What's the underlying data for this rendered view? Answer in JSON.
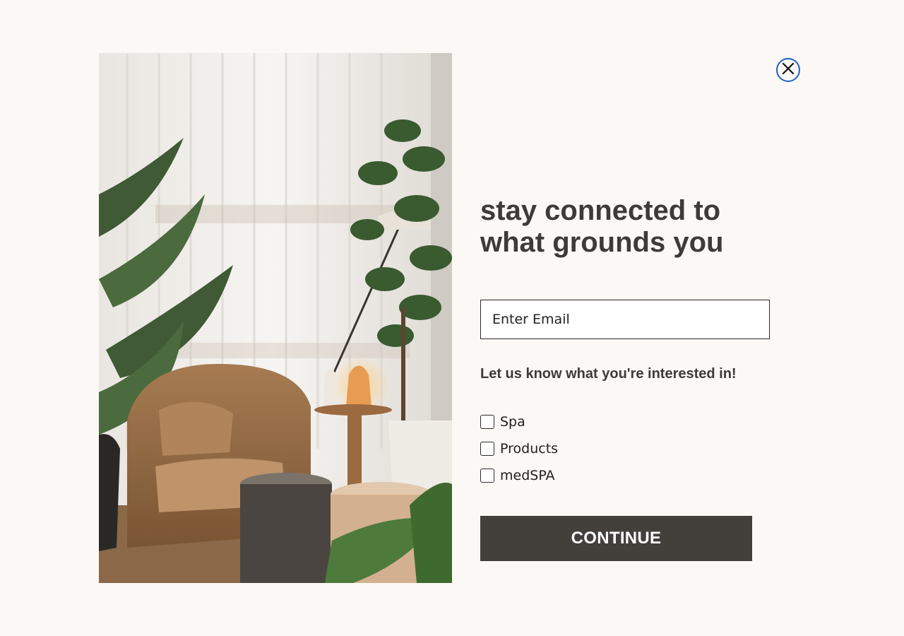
{
  "modal": {
    "headline": "stay connected to what grounds you",
    "email_placeholder": "Enter Email",
    "interest_prompt": "Let us know what you're interested in!",
    "options": [
      {
        "label": "Spa",
        "checked": false
      },
      {
        "label": "Products",
        "checked": false
      },
      {
        "label": "medSPA",
        "checked": false
      }
    ],
    "continue_label": "CONTINUE",
    "close_icon": "close-icon",
    "colors": {
      "background": "#fbf8f5",
      "heading": "#3d3b38",
      "button": "#43403c",
      "close_ring": "#1e63c4"
    }
  }
}
